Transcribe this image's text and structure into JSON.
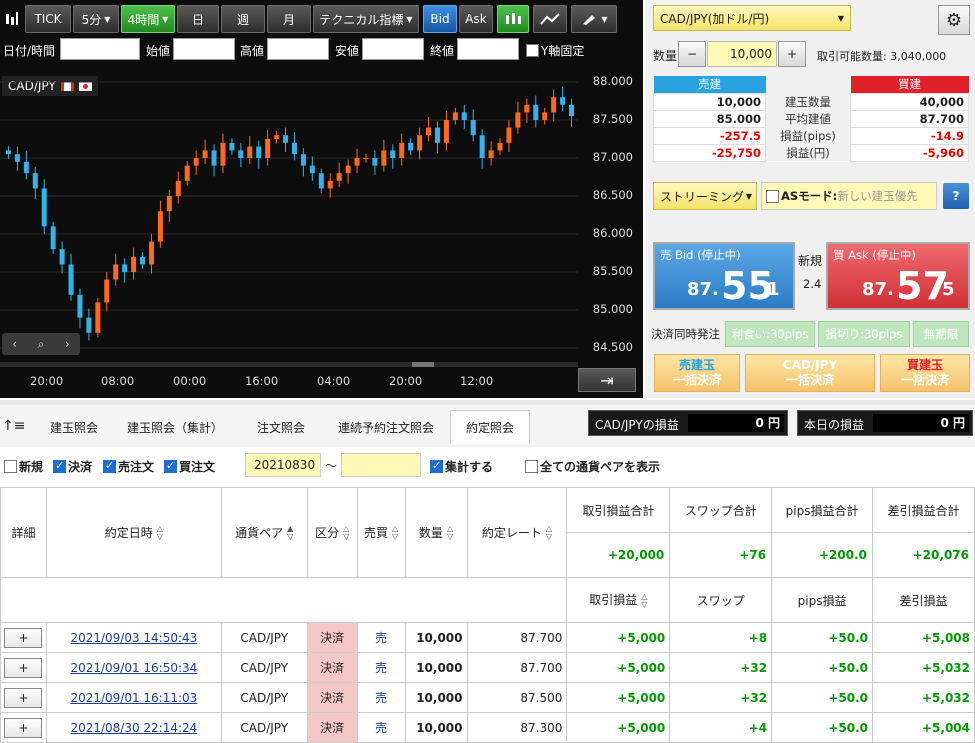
{
  "toolbar": {
    "tick": "TICK",
    "m5": "5分",
    "h4": "4時間",
    "day": "日",
    "week": "週",
    "month": "月",
    "indicator": "テクニカル指標",
    "bid": "Bid",
    "ask": "Ask"
  },
  "ohlc": {
    "datetime": "日付/時間",
    "open": "始値",
    "high": "高値",
    "low": "安値",
    "close": "終値",
    "yfix": "Y軸固定"
  },
  "chart_label": "CAD/JPY",
  "chart_data": {
    "type": "candlestick",
    "yticks": [
      "88.000",
      "87.500",
      "87.000",
      "86.500",
      "86.000",
      "85.500",
      "85.000",
      "84.500"
    ],
    "xticks": [
      "20:00",
      "08:00",
      "00:00",
      "16:00",
      "04:00",
      "20:00",
      "12:00"
    ],
    "ylim": [
      84.5,
      88.0
    ],
    "closes": [
      87.05,
      86.95,
      86.8,
      86.6,
      86.1,
      85.8,
      85.6,
      85.2,
      84.9,
      84.7,
      85.1,
      85.4,
      85.6,
      85.5,
      85.7,
      85.6,
      85.9,
      86.3,
      86.5,
      86.7,
      86.9,
      87.0,
      87.1,
      86.9,
      87.2,
      87.1,
      87.0,
      87.15,
      87.0,
      87.25,
      87.3,
      87.2,
      87.05,
      86.9,
      86.8,
      86.6,
      86.7,
      86.8,
      86.9,
      87.0,
      87.0,
      86.9,
      87.1,
      87.0,
      87.2,
      87.1,
      87.3,
      87.4,
      87.2,
      87.5,
      87.6,
      87.5,
      87.3,
      87.0,
      87.1,
      87.2,
      87.4,
      87.6,
      87.7,
      87.5,
      87.6,
      87.8,
      87.7,
      87.55
    ],
    "colors": {
      "up": "#ff6a1a",
      "down": "#33b3ea"
    }
  },
  "order": {
    "pair": "CAD/JPY(加ドル/円)",
    "qty_label": "数量",
    "qty_minus": "−",
    "qty_value": "10,000",
    "qty_plus": "+",
    "available": "取引可能数量: 3,040,000",
    "sell_header": "売建",
    "buy_header": "買建",
    "rows": [
      {
        "sell": "10,000",
        "label": "建玉数量",
        "buy": "40,000"
      },
      {
        "sell": "85.000",
        "label": "平均建値",
        "buy": "87.700"
      },
      {
        "sell": "-257.5",
        "label": "損益(pips)",
        "buy": "-14.9"
      },
      {
        "sell": "-25,750",
        "label": "損益(円)",
        "buy": "-5,960"
      }
    ],
    "mode": "ストリーミング",
    "as_mode": "ASモード:",
    "as_placeholder": "新しい建玉優先",
    "help": "?",
    "bid_label": "売 Bid (停止中)",
    "bid_main": "87.",
    "bid_big": "55",
    "bid_small": "1",
    "new_label": "新規",
    "spread": "2.4",
    "ask_label": "買 Ask (停止中)",
    "ask_main": "87.",
    "ask_big": "57",
    "ask_small": "5",
    "settle_label": "決済同時発注",
    "take_profit": "利食い:30pips",
    "stop_loss": "損切り:30pips",
    "unlimited": "無期限",
    "btn_sell_all_1": "売建玉",
    "btn_sell_all_2": "一括決済",
    "btn_pair_all_1": "CAD/JPY",
    "btn_pair_all_2": "一括決済",
    "btn_buy_all_1": "買建玉",
    "btn_buy_all_2": "一括決済"
  },
  "tabs": [
    "建玉照会",
    "建玉照会（集計）",
    "注文照会",
    "連続予約注文照会",
    "約定照会"
  ],
  "pl_pair_label": "CAD/JPYの損益",
  "pl_pair_value": "0 円",
  "pl_day_label": "本日の損益",
  "pl_day_value": "0 円",
  "filters": {
    "new": "新規",
    "settle": "決済",
    "sell": "売注文",
    "buy": "買注文",
    "date_from": "20210830",
    "tilde": "〜",
    "aggregate": "集計する",
    "all_pairs": "全ての通貨ペアを表示"
  },
  "grid": {
    "headers": [
      "詳細",
      "約定日時",
      "通貨ペア",
      "区分",
      "売買",
      "数量",
      "約定レート"
    ],
    "sum_headers": [
      "取引損益合計",
      "スワップ合計",
      "pips損益合計",
      "差引損益合計"
    ],
    "sums": [
      "+20,000",
      "+76",
      "+200.0",
      "+20,076"
    ],
    "sub_headers": [
      "取引損益",
      "スワップ",
      "pips損益",
      "差引損益"
    ],
    "rows": [
      {
        "btn": "+",
        "date": "2021/09/03 14:50:43",
        "pair": "CAD/JPY",
        "kind": "決済",
        "side": "売",
        "qty": "10,000",
        "rate": "87.700",
        "pl": "+5,000",
        "swap": "+8",
        "pips": "+50.0",
        "net": "+5,008"
      },
      {
        "btn": "+",
        "date": "2021/09/01 16:50:34",
        "pair": "CAD/JPY",
        "kind": "決済",
        "side": "売",
        "qty": "10,000",
        "rate": "87.700",
        "pl": "+5,000",
        "swap": "+32",
        "pips": "+50.0",
        "net": "+5,032"
      },
      {
        "btn": "+",
        "date": "2021/09/01 16:11:03",
        "pair": "CAD/JPY",
        "kind": "決済",
        "side": "売",
        "qty": "10,000",
        "rate": "87.500",
        "pl": "+5,000",
        "swap": "+32",
        "pips": "+50.0",
        "net": "+5,032"
      },
      {
        "btn": "+",
        "date": "2021/08/30 22:14:24",
        "pair": "CAD/JPY",
        "kind": "決済",
        "side": "売",
        "qty": "10,000",
        "rate": "87.300",
        "pl": "+5,000",
        "swap": "+4",
        "pips": "+50.0",
        "net": "+5,004"
      }
    ]
  }
}
